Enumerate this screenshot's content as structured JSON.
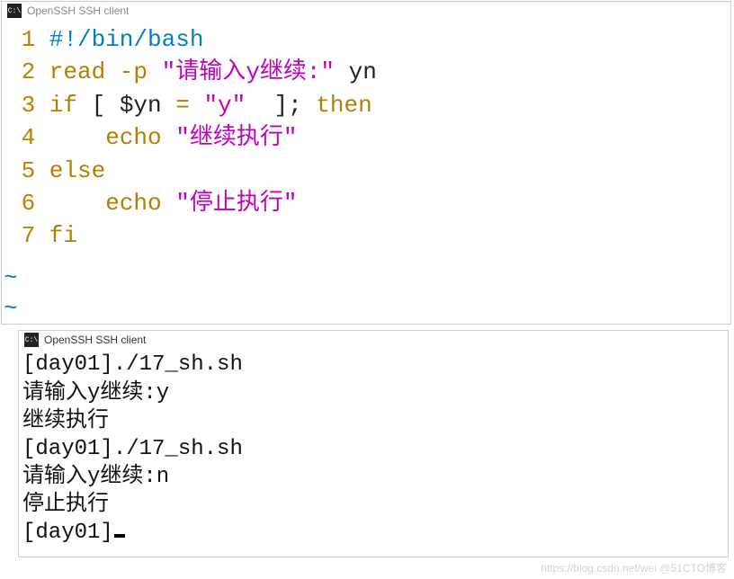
{
  "top_window": {
    "title": "OpenSSH SSH client",
    "code": {
      "lines": [
        {
          "num": "1",
          "parts": [
            {
              "cls": "c-bash",
              "t": "#!/bin/bash"
            }
          ]
        },
        {
          "num": "2",
          "parts": [
            {
              "cls": "c-kw",
              "t": "read -p "
            },
            {
              "cls": "c-str",
              "t": "\"请输入y继续:\""
            },
            {
              "cls": "c-text",
              "t": " yn"
            }
          ]
        },
        {
          "num": "3",
          "parts": [
            {
              "cls": "c-kw",
              "t": "if"
            },
            {
              "cls": "c-text",
              "t": " [ $yn "
            },
            {
              "cls": "c-kw",
              "t": "="
            },
            {
              "cls": "c-text",
              "t": " "
            },
            {
              "cls": "c-str",
              "t": "\"y\""
            },
            {
              "cls": "c-text",
              "t": "  ]; "
            },
            {
              "cls": "c-kw",
              "t": "then"
            }
          ]
        },
        {
          "num": "4",
          "parts": [
            {
              "cls": "c-text",
              "t": "    "
            },
            {
              "cls": "c-kw",
              "t": "echo"
            },
            {
              "cls": "c-text",
              "t": " "
            },
            {
              "cls": "c-str",
              "t": "\"继续执行\""
            }
          ]
        },
        {
          "num": "5",
          "parts": [
            {
              "cls": "c-kw",
              "t": "else"
            }
          ]
        },
        {
          "num": "6",
          "parts": [
            {
              "cls": "c-text",
              "t": "    "
            },
            {
              "cls": "c-kw",
              "t": "echo"
            },
            {
              "cls": "c-text",
              "t": " "
            },
            {
              "cls": "c-str",
              "t": "\"停止执行\""
            }
          ]
        },
        {
          "num": "7",
          "parts": [
            {
              "cls": "c-kw",
              "t": "fi"
            }
          ]
        }
      ]
    },
    "tilde": "~"
  },
  "bottom_window": {
    "title": "OpenSSH SSH client",
    "output": [
      "[day01]./17_sh.sh",
      "请输入y继续:y",
      "继续执行",
      "[day01]./17_sh.sh",
      "请输入y继续:n",
      "停止执行",
      "[day01]"
    ]
  },
  "watermark": "https://blog.csdn.net/wei @51CTO博客"
}
